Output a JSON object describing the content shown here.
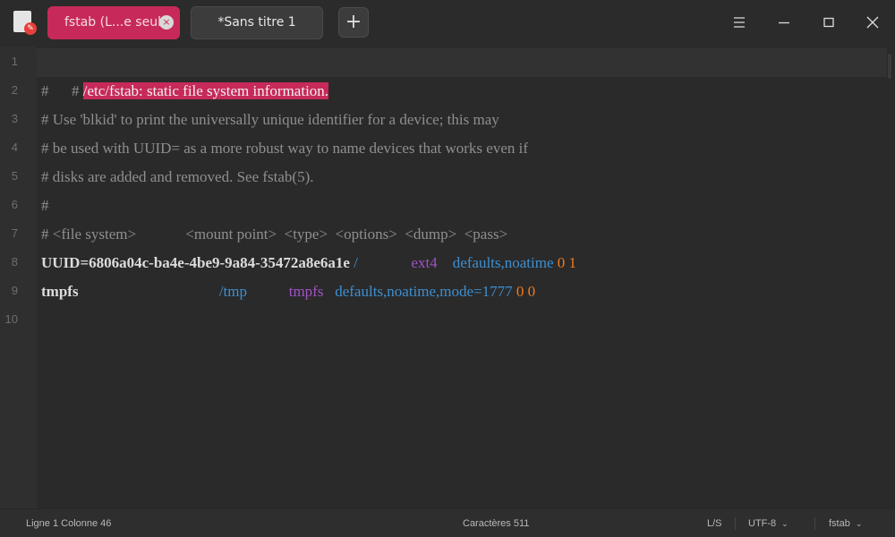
{
  "window": {
    "tabs": [
      {
        "label": "fstab (L...e seule)",
        "active": true
      },
      {
        "label": "*Sans titre 1",
        "active": false
      }
    ],
    "new_tab_label": "+",
    "close_tab_label": "×"
  },
  "icons": {
    "app": "text-editor-icon",
    "menu": "hamburger-menu-icon",
    "minimize": "minimize-icon",
    "maximize": "maximize-icon",
    "close": "close-icon"
  },
  "colors": {
    "accent": "#c72a5a",
    "background": "#2b2b2b",
    "comment": "#8f8f8f",
    "keyword_blue": "#3d8fd1",
    "keyword_purple": "#a052c6",
    "number_orange": "#f07a1d"
  },
  "editor": {
    "current_line": 1,
    "lines": [
      {
        "number": "1",
        "comment_prefix": "# ",
        "selected_text": "/etc/fstab: static file system information."
      },
      {
        "number": "2",
        "text": "#"
      },
      {
        "number": "3",
        "text": "# Use 'blkid' to print the universally unique identifier for a device; this may"
      },
      {
        "number": "4",
        "text": "# be used with UUID= as a more robust way to name devices that works even if"
      },
      {
        "number": "5",
        "text": "# disks are added and removed. See fstab(5)."
      },
      {
        "number": "6",
        "text": "#"
      },
      {
        "number": "7",
        "text": "# <file system>             <mount point>  <type>  <options>  <dump>  <pass>"
      },
      {
        "number": "8",
        "fs": "UUID=6806a04c-ba4e-4be9-9a84-35472a8e6a1e",
        "mount": "/",
        "type": "ext4",
        "options": "defaults,noatime",
        "dump": "0",
        "pass": "1"
      },
      {
        "number": "9",
        "fs": "tmpfs",
        "mount": "/tmp",
        "type": "tmpfs",
        "options": "defaults,noatime,mode=1777",
        "dump": "0",
        "pass": "0"
      },
      {
        "number": "10",
        "text": ""
      }
    ]
  },
  "statusbar": {
    "position": "Ligne 1  Colonne 46",
    "characters": "Caractères 511",
    "line_ending": "L/S",
    "encoding": "UTF-8",
    "language": "fstab"
  }
}
